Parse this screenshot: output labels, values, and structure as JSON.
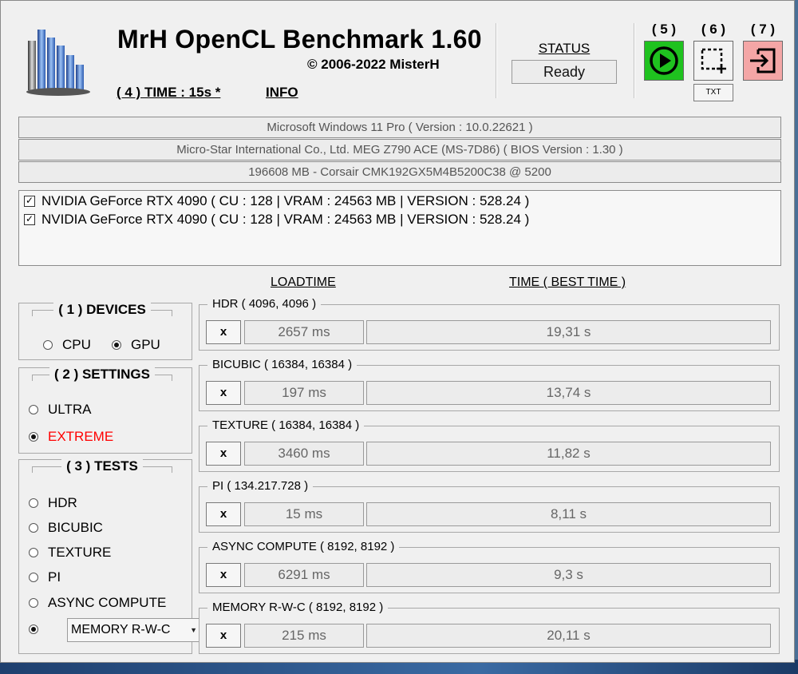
{
  "header": {
    "title": "MrH OpenCL Benchmark 1.60",
    "copyright_symbol": "©",
    "copyright": "2006-2022 MisterH",
    "time_link": "( 4 ) TIME : 15s *",
    "info_link": "INFO"
  },
  "status": {
    "label": "STATUS",
    "value": "Ready"
  },
  "buttons": {
    "run_number": "( 5 )",
    "capture_number": "( 6 )",
    "exit_number": "( 7 )",
    "txt_label": "TXT"
  },
  "system_info": [
    "Microsoft Windows 11 Pro ( Version : 10.0.22621 )",
    "Micro-Star International Co., Ltd. MEG Z790 ACE (MS-7D86) ( BIOS Version : 1.30 )",
    "196608 MB - Corsair CMK192GX5M4B5200C38  @ 5200"
  ],
  "gpus": [
    "NVIDIA GeForce RTX 4090 ( CU : 128 | VRAM : 24563 MB | VERSION : 528.24 )",
    "NVIDIA GeForce RTX 4090 ( CU : 128 | VRAM : 24563 MB | VERSION : 528.24 )"
  ],
  "columns": {
    "loadtime": "LOADTIME",
    "time": "TIME ( BEST TIME )"
  },
  "devices": {
    "title": "( 1 ) DEVICES",
    "cpu": "CPU",
    "gpu": "GPU",
    "selected": "GPU"
  },
  "settings": {
    "title": "( 2 ) SETTINGS",
    "ultra": "ULTRA",
    "extreme": "EXTREME",
    "selected": "EXTREME",
    "extreme_color": "#ff0000"
  },
  "tests_panel": {
    "title": "( 3 ) TESTS",
    "options": [
      "HDR",
      "BICUBIC",
      "TEXTURE",
      "PI",
      "ASYNC COMPUTE"
    ],
    "combo_value": "MEMORY R-W-C"
  },
  "results": [
    {
      "name": "HDR ( 4096, 4096 )",
      "x": "x",
      "load": "2657 ms",
      "time": "19,31 s"
    },
    {
      "name": "BICUBIC ( 16384, 16384 )",
      "x": "x",
      "load": "197 ms",
      "time": "13,74 s"
    },
    {
      "name": "TEXTURE ( 16384, 16384 )",
      "x": "x",
      "load": "3460 ms",
      "time": "11,82 s"
    },
    {
      "name": "PI ( 134.217.728 )",
      "x": "x",
      "load": "15 ms",
      "time": "8,11 s"
    },
    {
      "name": "ASYNC COMPUTE ( 8192, 8192 )",
      "x": "x",
      "load": "6291 ms",
      "time": "9,3 s"
    },
    {
      "name": "MEMORY R-W-C ( 8192, 8192 )",
      "x": "x",
      "load": "215 ms",
      "time": "20,11 s"
    }
  ],
  "colors": {
    "run_button": "#1fc21f",
    "exit_button": "#f4a6a6"
  }
}
